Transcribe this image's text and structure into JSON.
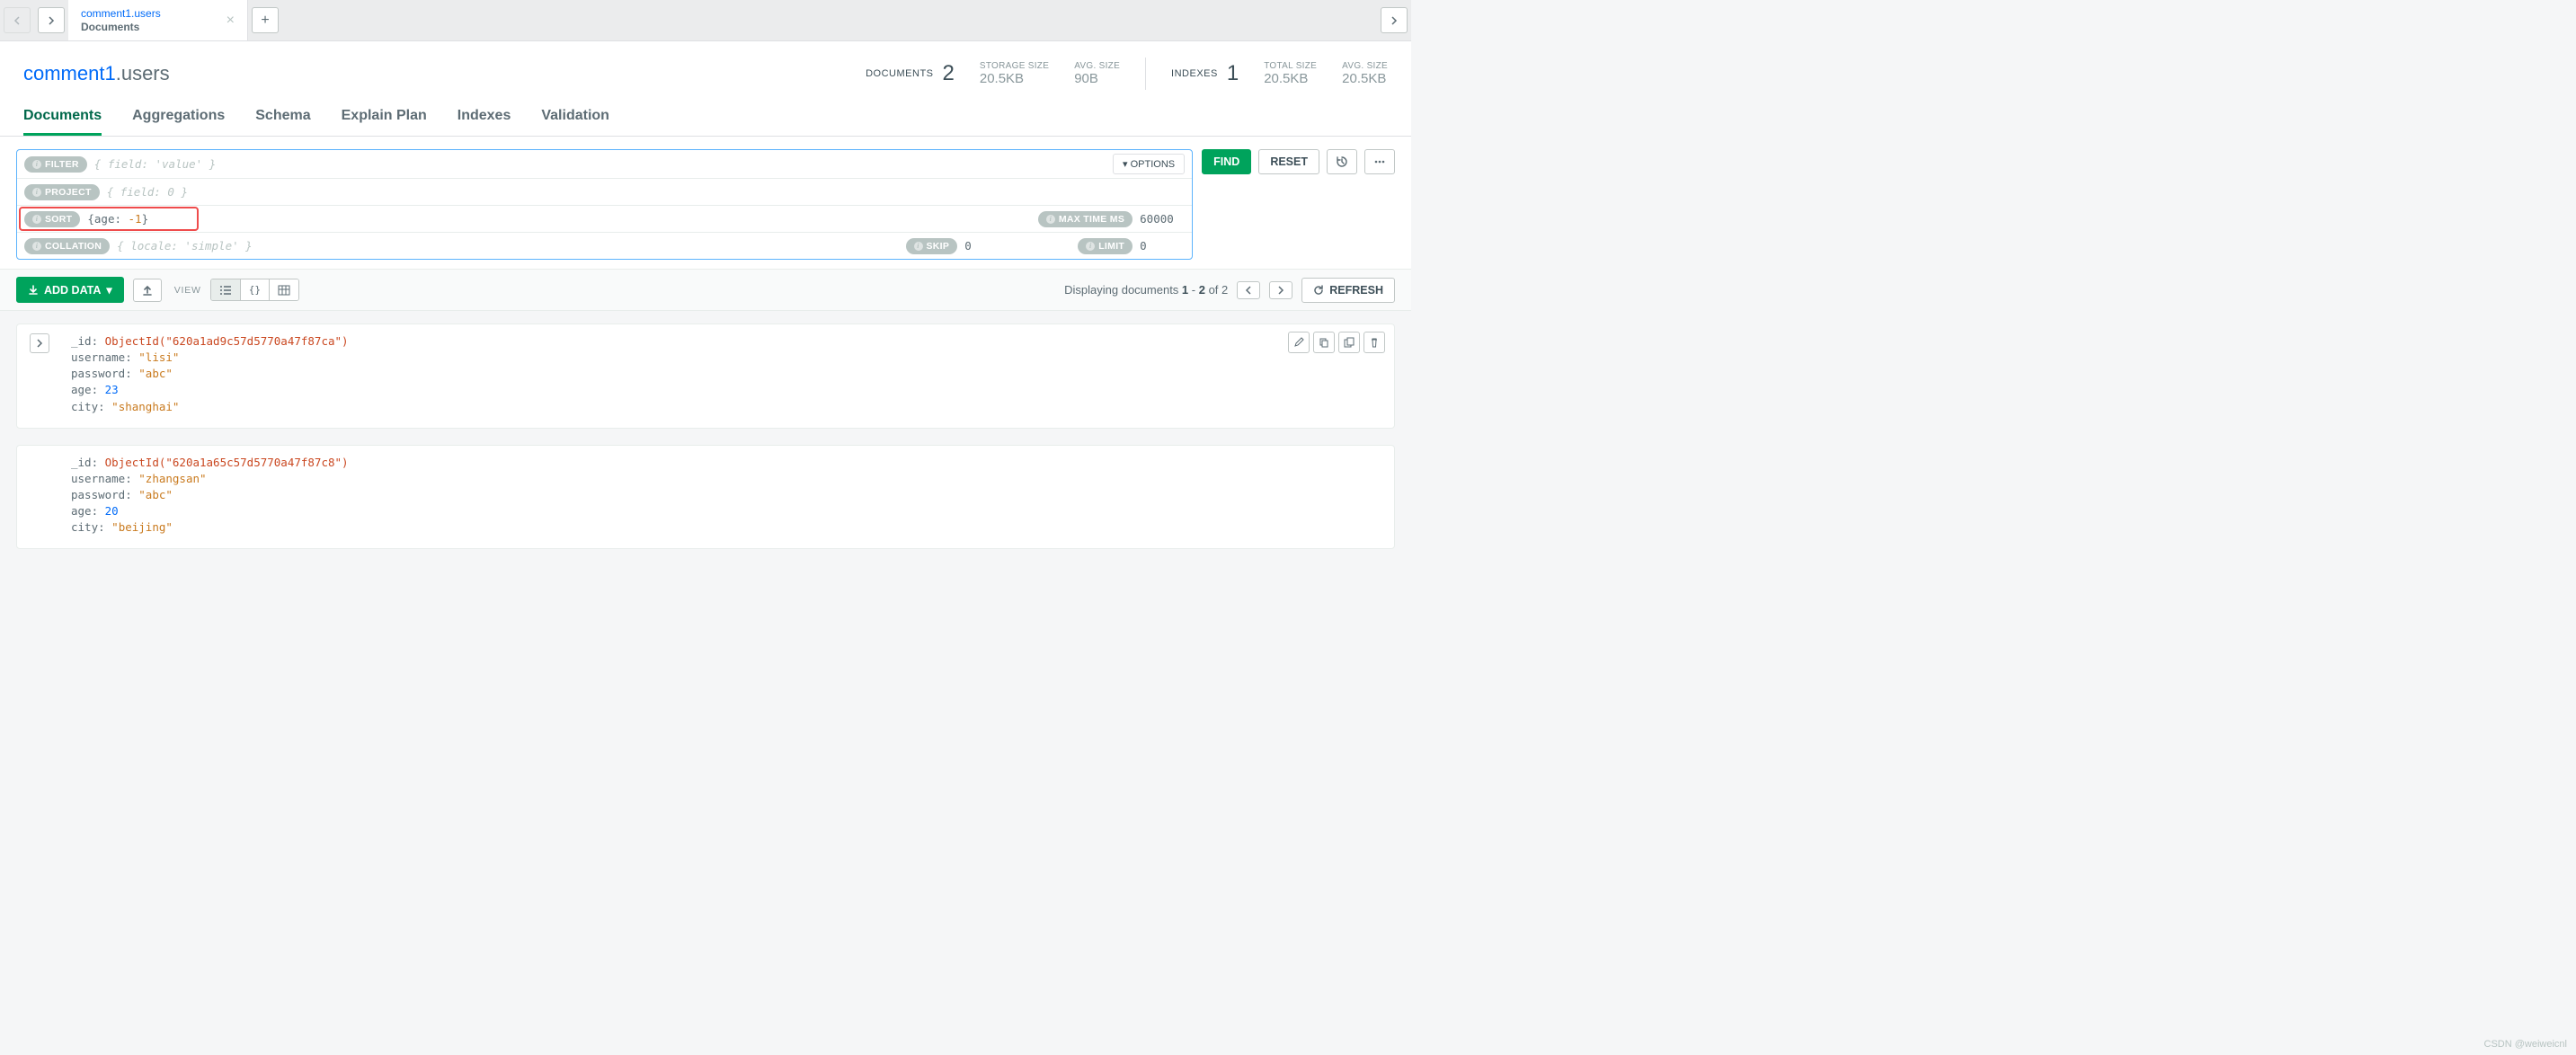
{
  "tab": {
    "title": "comment1.users",
    "subtitle": "Documents"
  },
  "namespace": {
    "db": "comment1",
    "coll": ".users"
  },
  "stats": {
    "documents_label": "DOCUMENTS",
    "documents_value": "2",
    "storage_label": "STORAGE SIZE",
    "storage_value": "20.5KB",
    "avg_label": "AVG. SIZE",
    "avg_value": "90B",
    "indexes_label": "INDEXES",
    "indexes_value": "1",
    "total_label": "TOTAL SIZE",
    "total_value": "20.5KB",
    "avg2_label": "AVG. SIZE",
    "avg2_value": "20.5KB"
  },
  "nav_tabs": {
    "documents": "Documents",
    "aggregations": "Aggregations",
    "schema": "Schema",
    "explain": "Explain Plan",
    "indexes": "Indexes",
    "validation": "Validation"
  },
  "query": {
    "filter_label": "FILTER",
    "filter_placeholder": "{ field: 'value' }",
    "project_label": "PROJECT",
    "project_placeholder": "{ field: 0 }",
    "sort_label": "SORT",
    "sort_value_prefix": "{age: ",
    "sort_value_num": "-1",
    "sort_value_suffix": "}",
    "maxtime_label": "MAX TIME MS",
    "maxtime_value": "60000",
    "collation_label": "COLLATION",
    "collation_placeholder": "{ locale: 'simple' }",
    "skip_label": "SKIP",
    "skip_value": "0",
    "limit_label": "LIMIT",
    "limit_value": "0",
    "options_label": "▾ OPTIONS",
    "find_label": "FIND",
    "reset_label": "RESET"
  },
  "toolbar": {
    "add_data": "ADD DATA",
    "view_label": "VIEW",
    "displaying_prefix": "Displaying documents ",
    "range_from": "1",
    "range_dash": " - ",
    "range_to": "2",
    "of_text": " of ",
    "total": "2",
    "refresh_label": "REFRESH"
  },
  "docs": [
    {
      "fields": [
        {
          "k": "_id",
          "type": "obj",
          "v": "ObjectId(\"620a1ad9c57d5770a47f87ca\")"
        },
        {
          "k": "username",
          "type": "str",
          "v": "\"lisi\""
        },
        {
          "k": "password",
          "type": "str",
          "v": "\"abc\""
        },
        {
          "k": "age",
          "type": "num",
          "v": "23"
        },
        {
          "k": "city",
          "type": "str",
          "v": "\"shanghai\""
        }
      ],
      "show_expand": true,
      "show_actions": true
    },
    {
      "fields": [
        {
          "k": "_id",
          "type": "obj",
          "v": "ObjectId(\"620a1a65c57d5770a47f87c8\")"
        },
        {
          "k": "username",
          "type": "str",
          "v": "\"zhangsan\""
        },
        {
          "k": "password",
          "type": "str",
          "v": "\"abc\""
        },
        {
          "k": "age",
          "type": "num",
          "v": "20"
        },
        {
          "k": "city",
          "type": "str",
          "v": "\"beijing\""
        }
      ],
      "show_expand": false,
      "show_actions": false
    }
  ],
  "watermark": "CSDN @weiweicnl"
}
